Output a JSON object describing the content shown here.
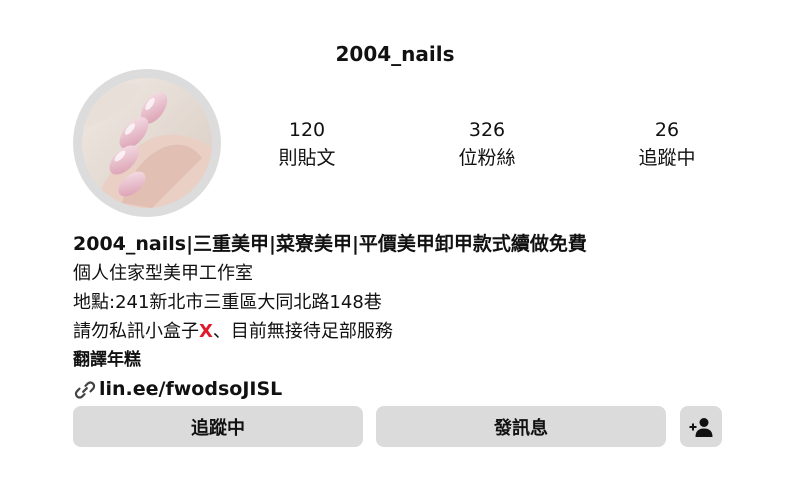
{
  "profile": {
    "username": "2004_nails",
    "stats": [
      {
        "value": "120",
        "label": "則貼文"
      },
      {
        "value": "326",
        "label": "位粉絲"
      },
      {
        "value": "26",
        "label": "追蹤中"
      }
    ]
  },
  "bio": {
    "name": "2004_nails|三重美甲|菜寮美甲|平價美甲卸甲款式續做免費",
    "line1": "個人住家型美甲工作室",
    "line2": "地點:241新北市三重區大同北路148巷",
    "line3_before": "請勿私訊小盒子",
    "line3_mark": "X",
    "line3_after": "、目前無接待足部服務",
    "translate_label": "翻譯年糕",
    "link_text": "lin.ee/fwodsoJISL"
  },
  "actions": {
    "follow_label": "追蹤中",
    "message_label": "發訊息"
  },
  "icons": {
    "link": "link-icon",
    "add_user": "add-user-icon"
  },
  "colors": {
    "button_bg": "#dbdbdb",
    "avatar_ring": "#dcdcdc",
    "x_mark": "#e0192b"
  }
}
